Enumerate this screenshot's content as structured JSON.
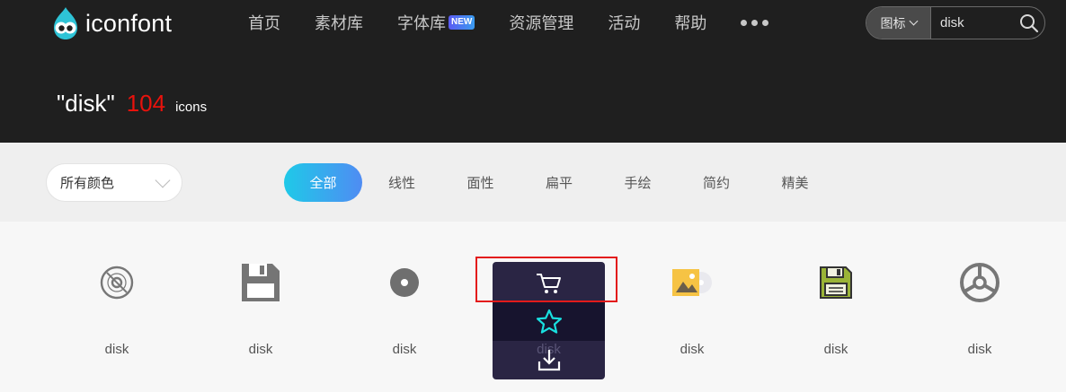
{
  "brand": {
    "name": "iconfont"
  },
  "nav": {
    "items": [
      {
        "label": "首页"
      },
      {
        "label": "素材库"
      },
      {
        "label": "字体库",
        "badge": "NEW"
      },
      {
        "label": "资源管理"
      },
      {
        "label": "活动"
      },
      {
        "label": "帮助"
      }
    ]
  },
  "search": {
    "type_label": "图标",
    "value": "disk"
  },
  "result": {
    "query": "\"disk\"",
    "count": "104",
    "unit": "icons"
  },
  "filter": {
    "color_select": "所有颜色",
    "tabs": [
      {
        "label": "全部",
        "active": true
      },
      {
        "label": "线性"
      },
      {
        "label": "面性"
      },
      {
        "label": "扁平"
      },
      {
        "label": "手绘"
      },
      {
        "label": "简约"
      },
      {
        "label": "精美"
      }
    ]
  },
  "icons": [
    {
      "label": "disk",
      "icon": "disc-outline-icon"
    },
    {
      "label": "disk",
      "icon": "floppy-disk-icon"
    },
    {
      "label": "disk",
      "icon": "disk-dot-icon"
    },
    {
      "label": "disk",
      "icon": "disk-hidden-icon"
    },
    {
      "label": "disk",
      "icon": "image-disc-icon"
    },
    {
      "label": "disk",
      "icon": "floppy-disk-color-icon"
    },
    {
      "label": "disk",
      "icon": "wheel-disk-icon"
    }
  ],
  "hover_actions": [
    "cart-icon",
    "star-icon",
    "download-icon"
  ],
  "colors": {
    "header_bg": "#1f1f1f",
    "count": "#e8120c",
    "tab_gradient_start": "#1fc9e8",
    "tab_gradient_end": "#4f8cf3",
    "star_accent": "#19e0e0",
    "highlight": "#e31b1b"
  }
}
